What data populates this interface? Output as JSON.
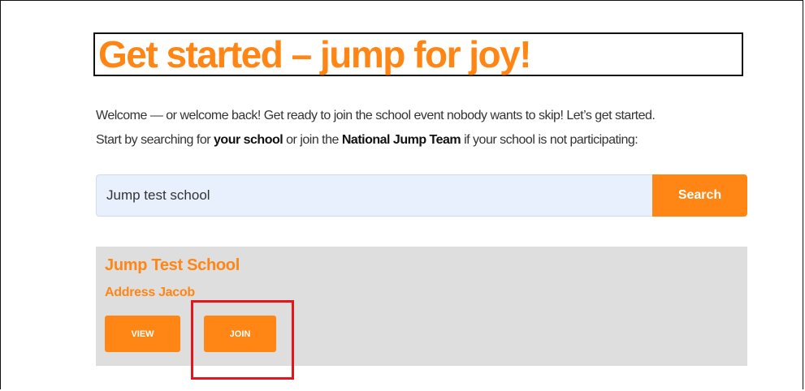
{
  "page": {
    "title": "Get started – jump for joy!",
    "intro": {
      "line1": "Welcome — or welcome back! Get ready to join the school event nobody wants to skip! Let’s get started.",
      "line2_prefix": "Start by searching for ",
      "line2_bold1": "your school",
      "line2_middle": " or join the ",
      "line2_bold2": "National Jump Team",
      "line2_suffix": " if your school is not participating:"
    }
  },
  "search": {
    "value": "Jump test school",
    "button_label": "Search"
  },
  "result": {
    "name": "Jump Test School",
    "address": "Address Jacob",
    "view_label": "VIEW",
    "join_label": "JOIN"
  },
  "colors": {
    "accent": "#ff8614",
    "input_bg": "#e8f0fe",
    "card_bg": "#dedede",
    "highlight": "#e8141c"
  }
}
